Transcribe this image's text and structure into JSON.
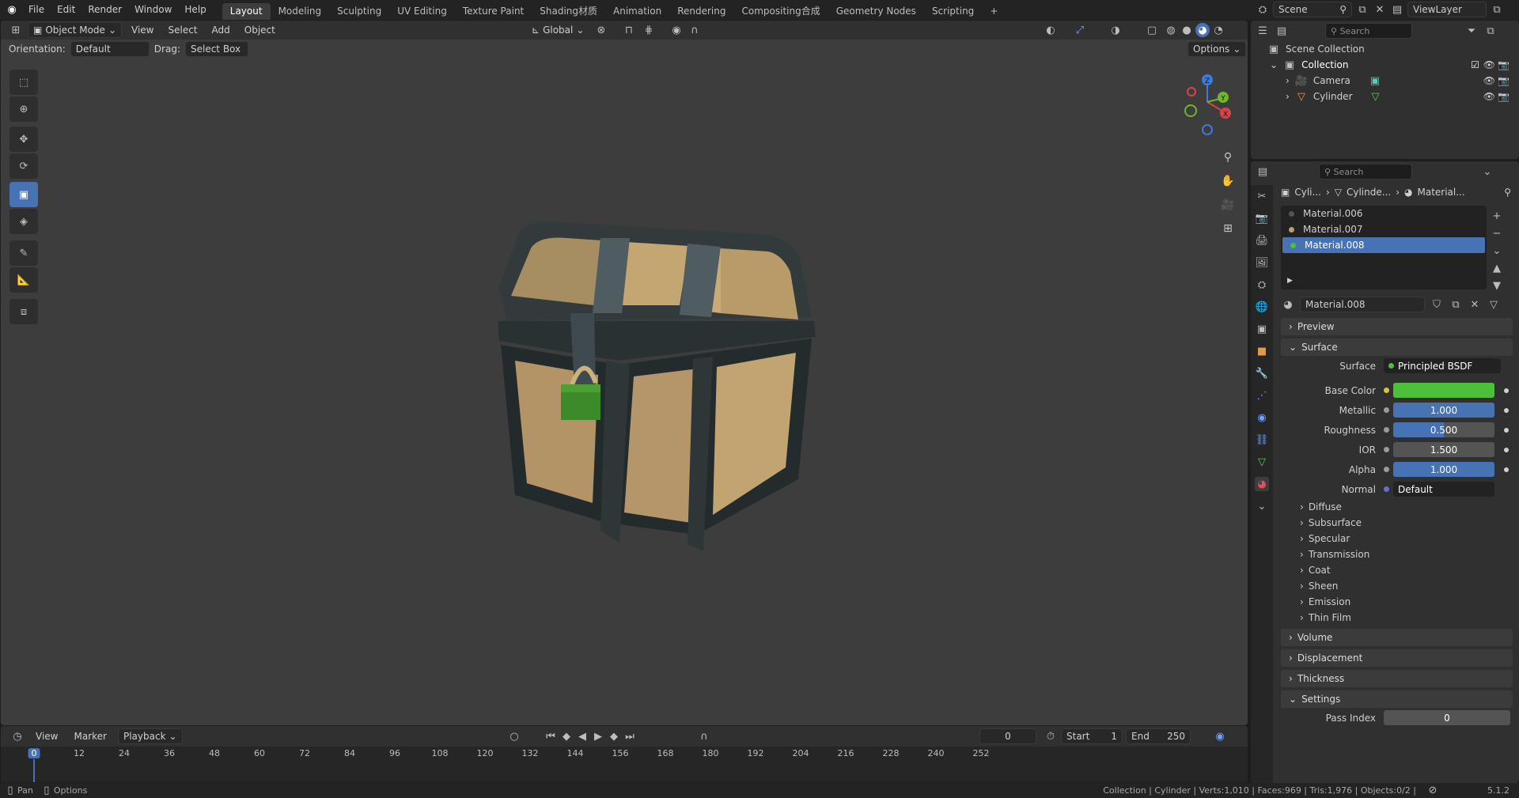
{
  "topbar": {
    "menus": [
      "File",
      "Edit",
      "Render",
      "Window",
      "Help"
    ],
    "workspaces": [
      "Layout",
      "Modeling",
      "Sculpting",
      "UV Editing",
      "Texture Paint",
      "Shading材质",
      "Animation",
      "Rendering",
      "Compositing合成",
      "Geometry Nodes",
      "Scripting"
    ],
    "active_workspace": "Layout",
    "scene": "Scene",
    "view_layer": "ViewLayer"
  },
  "viewport": {
    "mode": "Object Mode",
    "menus": [
      "View",
      "Select",
      "Add",
      "Object"
    ],
    "transform_orientation": "Global",
    "orientation_label": "Orientation:",
    "orientation_value": "Default",
    "drag_label": "Drag:",
    "drag_value": "Select Box",
    "options": "Options",
    "gizmo": {
      "z": "Z",
      "x": "X",
      "y": "Y"
    }
  },
  "timeline": {
    "menus": [
      "View",
      "Marker"
    ],
    "playback": "Playback",
    "current_frame": "0",
    "start_label": "Start",
    "start": "1",
    "end_label": "End",
    "end": "250",
    "ticks": [
      "0",
      "12",
      "24",
      "36",
      "48",
      "60",
      "72",
      "84",
      "96",
      "108",
      "120",
      "132",
      "144",
      "156",
      "168",
      "180",
      "192",
      "204",
      "216",
      "228",
      "240",
      "252"
    ]
  },
  "status": {
    "pan": "Pan",
    "options": "Options",
    "info": "Collection | Cylinder | Verts:1,010 | Faces:969 | Tris:1,976 | Objects:0/2 |",
    "version": "5.1.2"
  },
  "outliner": {
    "search_placeholder": "Search",
    "root": "Scene Collection",
    "collection": "Collection",
    "items": [
      "Camera",
      "Cylinder"
    ]
  },
  "properties": {
    "search_placeholder": "Search",
    "breadcrumb": [
      "Cyli...",
      "Cylinde...",
      "Material..."
    ],
    "materials": [
      "Material.006",
      "Material.007",
      "Material.008"
    ],
    "selected_material": "Material.008",
    "panels": {
      "preview": "Preview",
      "surface": "Surface",
      "volume": "Volume",
      "displacement": "Displacement",
      "thickness": "Thickness",
      "settings": "Settings"
    },
    "surface_label": "Surface",
    "surface_shader": "Principled BSDF",
    "fields": [
      {
        "label": "Base Color",
        "value": "",
        "color": "#4cc03b"
      },
      {
        "label": "Metallic",
        "value": "1.000",
        "fill": 1.0
      },
      {
        "label": "Roughness",
        "value": "0.500",
        "fill": 0.5
      },
      {
        "label": "IOR",
        "value": "1.500",
        "fill": 0.0
      },
      {
        "label": "Alpha",
        "value": "1.000",
        "fill": 1.0
      },
      {
        "label": "Normal",
        "value": "Default"
      }
    ],
    "subpanels": [
      "Diffuse",
      "Subsurface",
      "Specular",
      "Transmission",
      "Coat",
      "Sheen",
      "Emission",
      "Thin Film"
    ],
    "pass_index_label": "Pass Index",
    "pass_index": "0"
  },
  "colors": {
    "accent": "#4772b3",
    "base_color": "#4cc03b"
  }
}
